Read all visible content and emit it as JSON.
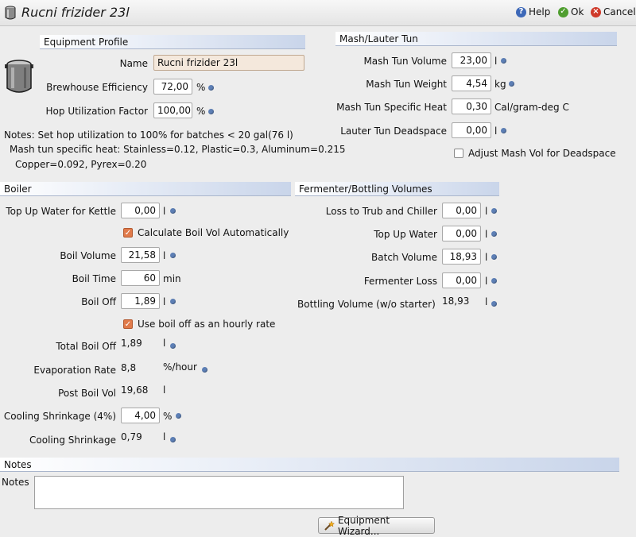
{
  "window": {
    "title": "Rucni frizider 23l",
    "help_label": "Help",
    "ok_label": "Ok",
    "cancel_label": "Cancel"
  },
  "equipment_profile": {
    "header": "Equipment Profile",
    "name_label": "Name",
    "name_value": "Rucni frizider 23l",
    "efficiency_label": "Brewhouse Efficiency",
    "efficiency_value": "72,00",
    "efficiency_unit": "%",
    "hop_label": "Hop Utilization Factor",
    "hop_value": "100,00",
    "hop_unit": "%",
    "notes_line1": "Notes: Set hop utilization to 100% for batches < 20 gal(76 l)",
    "notes_line2": "Mash tun specific heat: Stainless=0.12, Plastic=0.3, Aluminum=0.215",
    "notes_line3": "Copper=0.092, Pyrex=0.20"
  },
  "mash_lauter": {
    "header": "Mash/Lauter Tun",
    "volume_label": "Mash Tun Volume",
    "volume_value": "23,00",
    "volume_unit": "l",
    "weight_label": "Mash Tun Weight",
    "weight_value": "4,54",
    "weight_unit": "kg",
    "heat_label": "Mash Tun Specific Heat",
    "heat_value": "0,30",
    "heat_unit": "Cal/gram-deg C",
    "deadspace_label": "Lauter Tun Deadspace",
    "deadspace_value": "0,00",
    "deadspace_unit": "l",
    "adjust_label": "Adjust Mash Vol for Deadspace",
    "adjust_checked": false
  },
  "boiler": {
    "header": "Boiler",
    "topup_label": "Top Up Water for Kettle",
    "topup_value": "0,00",
    "topup_unit": "l",
    "calc_label": "Calculate Boil Vol Automatically",
    "calc_checked": true,
    "boil_volume_label": "Boil Volume",
    "boil_volume_value": "21,58",
    "boil_volume_unit": "l",
    "boil_time_label": "Boil Time",
    "boil_time_value": "60",
    "boil_time_unit": "min",
    "boil_off_label": "Boil Off",
    "boil_off_value": "1,89",
    "boil_off_unit": "l",
    "hourly_label": "Use boil off as an hourly rate",
    "hourly_checked": true,
    "total_boil_off_label": "Total Boil Off",
    "total_boil_off_value": "1,89",
    "total_boil_off_unit": "l",
    "evap_label": "Evaporation Rate",
    "evap_value": "8,8",
    "evap_unit": "%/hour",
    "post_boil_label": "Post Boil Vol",
    "post_boil_value": "19,68",
    "post_boil_unit": "l",
    "shrink_pct_label": "Cooling Shrinkage (4%)",
    "shrink_pct_value": "4,00",
    "shrink_pct_unit": "%",
    "shrink_label": "Cooling Shrinkage",
    "shrink_value": "0,79",
    "shrink_unit": "l"
  },
  "fermenter": {
    "header": "Fermenter/Bottling Volumes",
    "trub_label": "Loss to Trub and Chiller",
    "trub_value": "0,00",
    "trub_unit": "l",
    "topup_label": "Top Up Water",
    "topup_value": "0,00",
    "topup_unit": "l",
    "batch_label": "Batch Volume",
    "batch_value": "18,93",
    "batch_unit": "l",
    "loss_label": "Fermenter Loss",
    "loss_value": "0,00",
    "loss_unit": "l",
    "bottling_label": "Bottling Volume (w/o starter)",
    "bottling_value": "18,93",
    "bottling_unit": "l"
  },
  "notes": {
    "header": "Notes",
    "label": "Notes",
    "value": ""
  },
  "wizard": {
    "label": "Equipment Wizard..."
  },
  "colors": {
    "accent_dot": "#5d7fb5",
    "checkbox_on": "#e07a4a",
    "name_field_bg": "#f4e8dc"
  }
}
